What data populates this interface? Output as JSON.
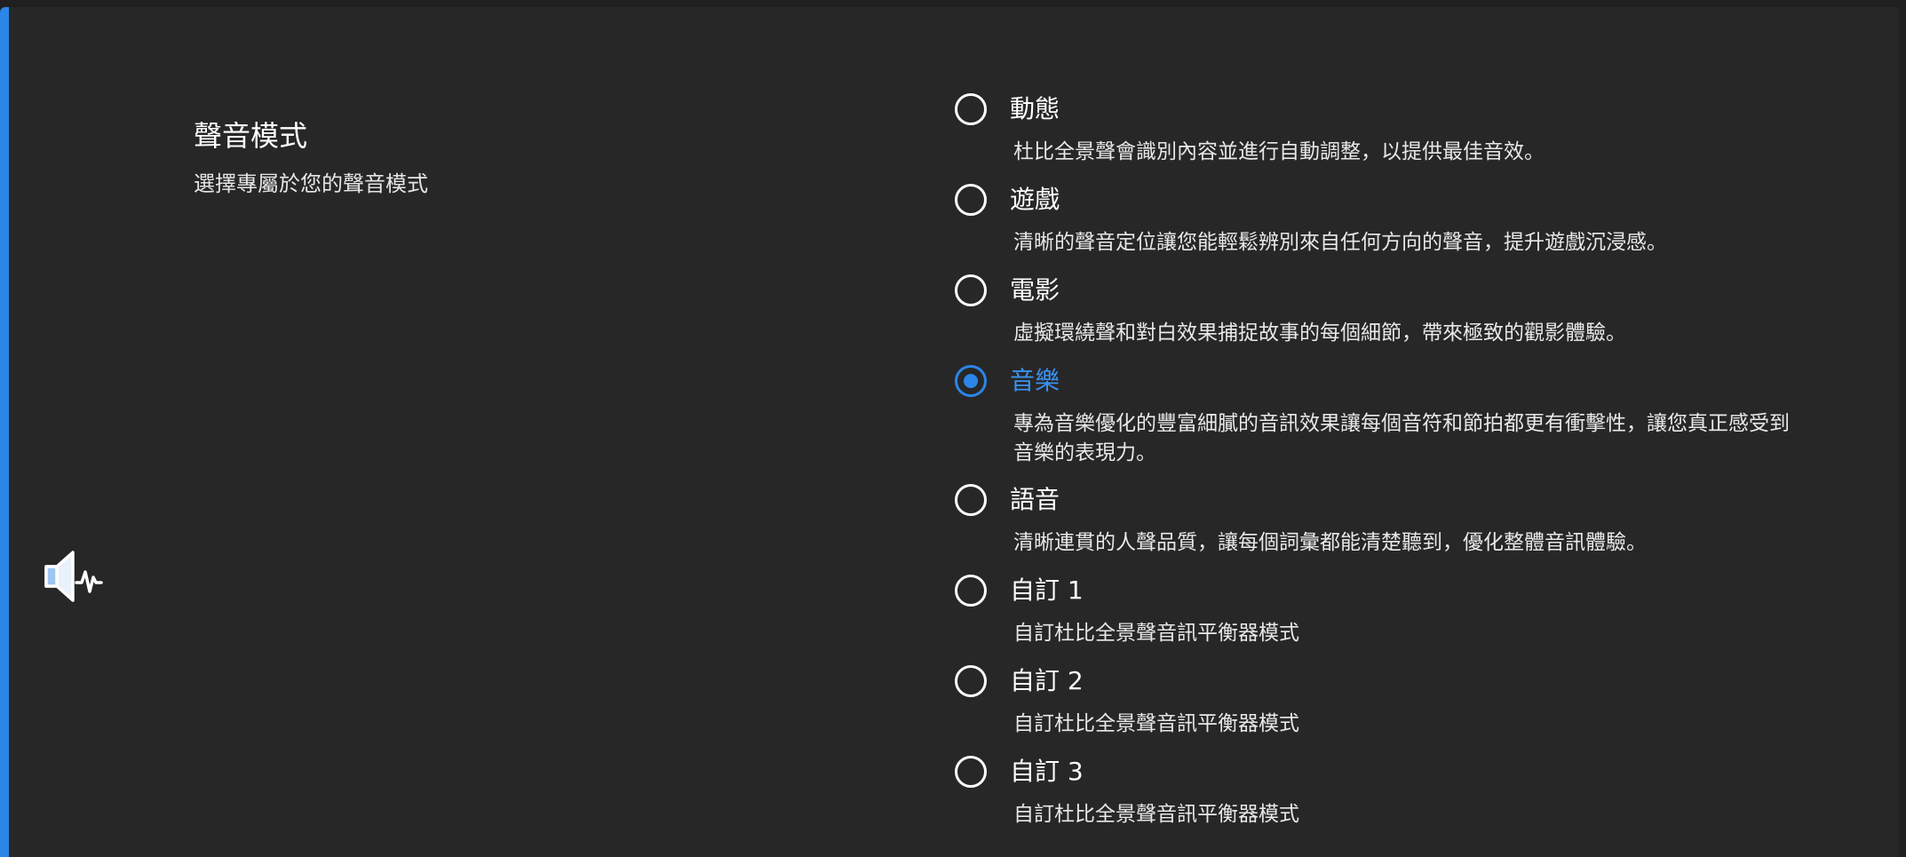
{
  "section": {
    "title": "聲音模式",
    "subtitle": "選擇專屬於您的聲音模式"
  },
  "icons": {
    "speaker": "speaker-waveform-icon"
  },
  "colors": {
    "accent": "#2b86e8",
    "background": "#272727",
    "text": "#ffffff"
  },
  "options": [
    {
      "label": "動態",
      "description": "杜比全景聲會識別內容並進行自動調整，以提供最佳音效。",
      "selected": false
    },
    {
      "label": "遊戲",
      "description": "清晰的聲音定位讓您能輕鬆辨別來自任何方向的聲音，提升遊戲沉浸感。",
      "selected": false
    },
    {
      "label": "電影",
      "description": "虛擬環繞聲和對白效果捕捉故事的每個細節，帶來極致的觀影體驗。",
      "selected": false
    },
    {
      "label": "音樂",
      "description": "專為音樂優化的豐富細膩的音訊效果讓每個音符和節拍都更有衝擊性，讓您真正感受到音樂的表現力。",
      "selected": true
    },
    {
      "label": "語音",
      "description": "清晰連貫的人聲品質，讓每個詞彙都能清楚聽到，優化整體音訊體驗。",
      "selected": false
    },
    {
      "label": "自訂 1",
      "description": "自訂杜比全景聲音訊平衡器模式",
      "selected": false
    },
    {
      "label": "自訂 2",
      "description": "自訂杜比全景聲音訊平衡器模式",
      "selected": false
    },
    {
      "label": "自訂 3",
      "description": "自訂杜比全景聲音訊平衡器模式",
      "selected": false
    }
  ]
}
